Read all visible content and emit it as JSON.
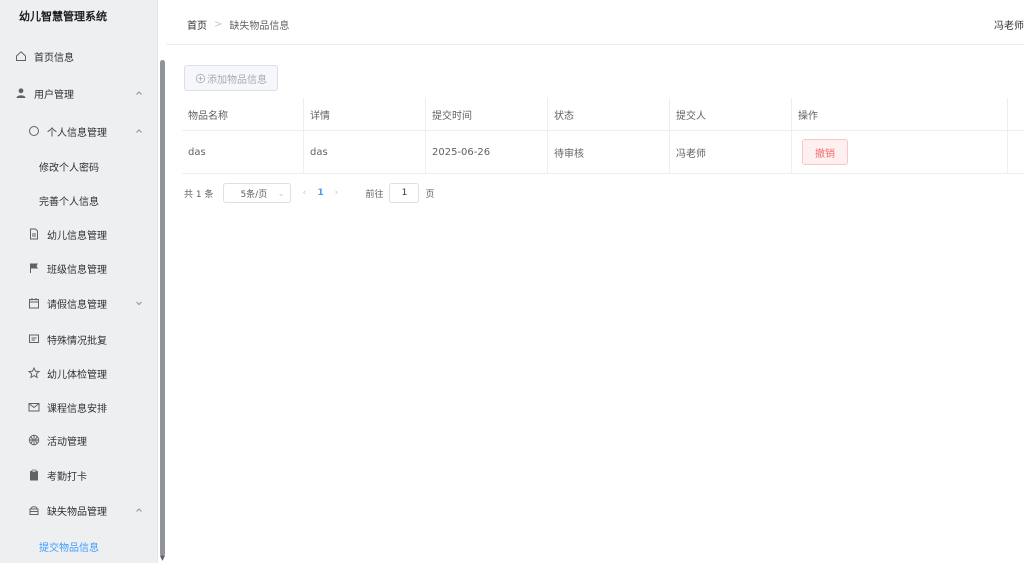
{
  "app": {
    "title": "幼儿智慧管理系统"
  },
  "sidebar": {
    "items": [
      {
        "label": "首页信息",
        "icon": "home-icon"
      },
      {
        "label": "用户管理",
        "icon": "user-icon"
      },
      {
        "label": "个人信息管理",
        "icon": "chat-icon"
      },
      {
        "label": "修改个人密码"
      },
      {
        "label": "完善个人信息"
      },
      {
        "label": "幼儿信息管理",
        "icon": "document-icon"
      },
      {
        "label": "班级信息管理",
        "icon": "flag-icon"
      },
      {
        "label": "请假信息管理",
        "icon": "calendar-icon"
      },
      {
        "label": "特殊情况批复",
        "icon": "message-icon"
      },
      {
        "label": "幼儿体检管理",
        "icon": "star-icon"
      },
      {
        "label": "课程信息安排",
        "icon": "mail-icon"
      },
      {
        "label": "活动管理",
        "icon": "basketball-icon"
      },
      {
        "label": "考勤打卡",
        "icon": "clipboard-icon"
      },
      {
        "label": "缺失物品管理",
        "icon": "box-icon"
      },
      {
        "label": "提交物品信息"
      }
    ]
  },
  "header": {
    "breadcrumb_home": "首页",
    "breadcrumb_separator": ">",
    "breadcrumb_current": "缺失物品信息",
    "user": "冯老师"
  },
  "toolbar": {
    "add_label": "添加物品信息"
  },
  "table": {
    "columns": [
      "物品名称",
      "详情",
      "提交时间",
      "状态",
      "提交人",
      "操作"
    ],
    "rows": [
      {
        "name": "das",
        "detail": "das",
        "time": "2025-06-26",
        "status": "待审核",
        "submitter": "冯老师",
        "action": "撤销"
      }
    ]
  },
  "pagination": {
    "total_text": "共 1 条",
    "page_size": "5条/页",
    "current_page": "1",
    "goto_label": "前往",
    "goto_value": "1",
    "page_suffix": "页"
  },
  "colors": {
    "accent": "#409eff",
    "danger": "#f56c6c",
    "sidebar_bg": "#eeeff1"
  }
}
